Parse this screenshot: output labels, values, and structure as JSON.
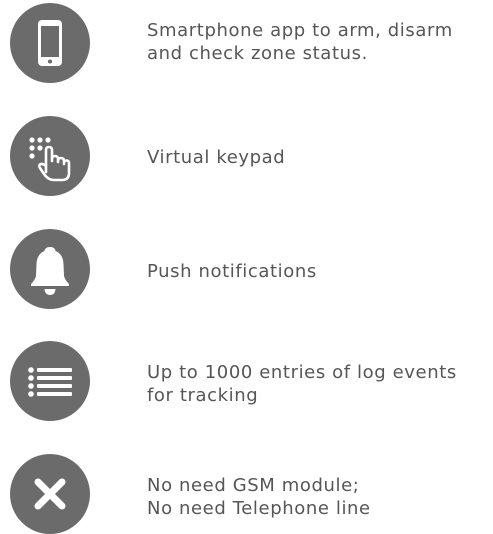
{
  "colors": {
    "icon_bg": "#6b6b6b",
    "icon_fg": "#ffffff",
    "text": "#565656"
  },
  "features": [
    {
      "icon": "smartphone-icon",
      "lines": [
        "Smartphone app to arm, disarm",
        "and check zone status."
      ]
    },
    {
      "icon": "keypad-hand-icon",
      "lines": [
        "Virtual keypad"
      ]
    },
    {
      "icon": "bell-icon",
      "lines": [
        "Push notifications"
      ]
    },
    {
      "icon": "list-icon",
      "lines": [
        "Up to 1000 entries of log events",
        "for  tracking"
      ]
    },
    {
      "icon": "close-x-icon",
      "lines": [
        "No need GSM module;",
        "No need Telephone line"
      ]
    }
  ]
}
